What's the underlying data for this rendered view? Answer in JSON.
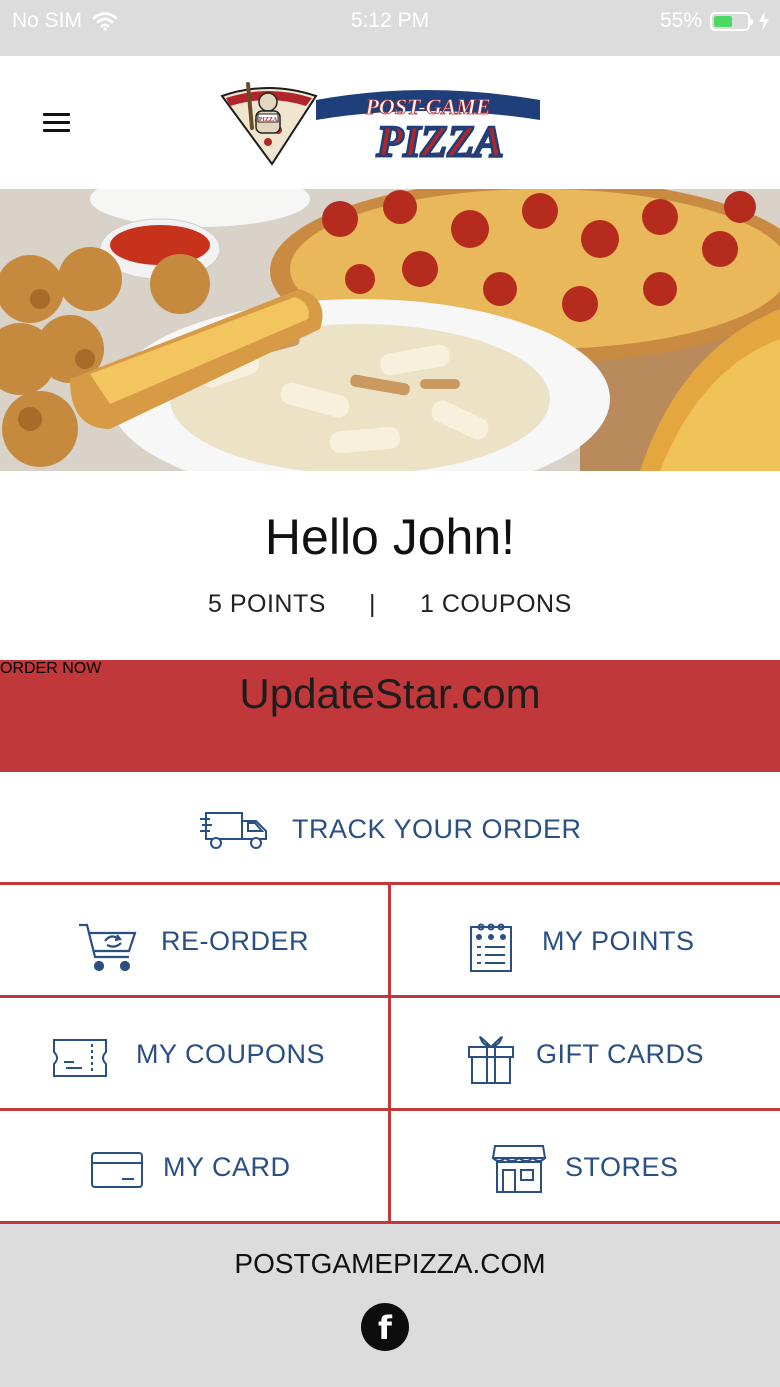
{
  "status_bar": {
    "carrier": "No SIM",
    "time": "5:12 PM",
    "battery_percent": "55%",
    "battery_level": 0.55,
    "icons": [
      "wifi-icon",
      "battery-icon",
      "charging-bolt-icon"
    ]
  },
  "header": {
    "menu_icon": "hamburger-menu-icon",
    "logo": {
      "line1": "POST-GAME",
      "line2": "PIZZA",
      "badge": "PIZZA"
    }
  },
  "hero": {
    "description_icon": "food-photo"
  },
  "greeting": {
    "title": "Hello John!",
    "points": "5 POINTS",
    "separator": "|",
    "coupons": "1 COUPONS"
  },
  "order": {
    "label": "ORDER NOW",
    "watermark": "UpdateStar.com"
  },
  "track": {
    "label": "TRACK YOUR ORDER",
    "icon": "delivery-truck-icon"
  },
  "menu": [
    {
      "label": "RE-ORDER",
      "icon": "cart-reorder-icon"
    },
    {
      "label": "MY POINTS",
      "icon": "points-list-icon"
    },
    {
      "label": "MY COUPONS",
      "icon": "coupon-ticket-icon"
    },
    {
      "label": "GIFT CARDS",
      "icon": "gift-icon"
    },
    {
      "label": "MY CARD",
      "icon": "credit-card-icon"
    },
    {
      "label": "STORES",
      "icon": "store-icon"
    }
  ],
  "footer": {
    "site": "POSTGAMEPIZZA.COM",
    "social": "facebook-icon",
    "facebook_glyph": "f"
  },
  "colors": {
    "brand_red": "#c0383a",
    "brand_blue": "#2a4f83",
    "footer_bg": "#dcdcdc"
  }
}
